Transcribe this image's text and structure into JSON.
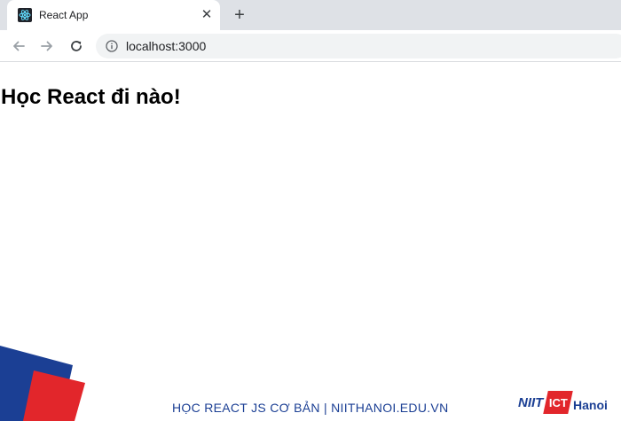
{
  "browser": {
    "tab": {
      "title": "React App",
      "favicon": "react-icon",
      "close_glyph": "✕"
    },
    "new_tab_glyph": "+",
    "toolbar": {
      "back_icon": "back-arrow-icon",
      "forward_icon": "forward-arrow-icon",
      "reload_icon": "reload-icon",
      "info_icon": "info-icon",
      "url": "localhost:3000"
    }
  },
  "page": {
    "heading": "Học React đi nào!"
  },
  "footer": {
    "caption": "HỌC REACT JS CƠ BẢN | NIITHANOI.EDU.VN",
    "logo": {
      "left_text": "NIIT",
      "mark_text": "ICT",
      "right_text": "Hanoi"
    }
  },
  "colors": {
    "accent_blue": "#1b3f94",
    "accent_red": "#e2262b",
    "tab_strip": "#dee1e6",
    "omnibox": "#f1f3f4"
  }
}
